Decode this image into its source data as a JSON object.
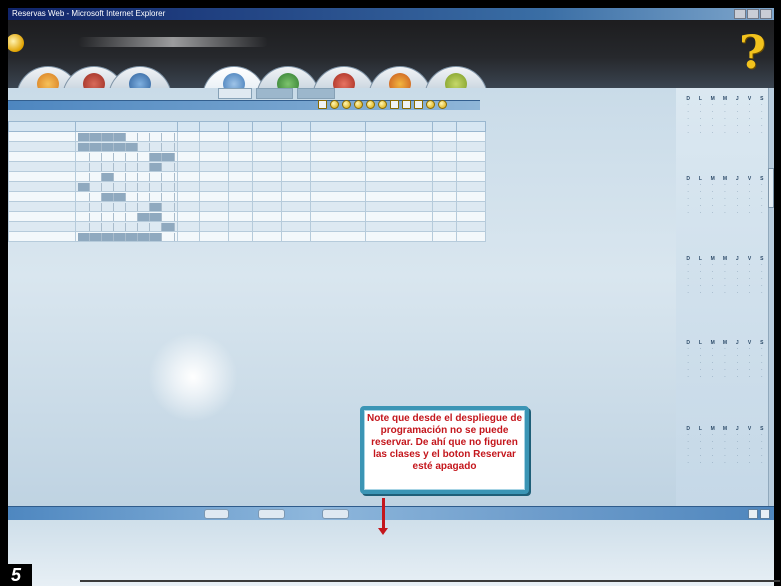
{
  "window": {
    "title": "Reservas Web - Microsoft Internet Explorer"
  },
  "header": {
    "help_glyph": "?"
  },
  "tabs": [
    {
      "name": "tab-1",
      "color": "#e08a2e"
    },
    {
      "name": "tab-2",
      "color": "#b33a2a"
    },
    {
      "name": "tab-3",
      "color": "#2d6db1"
    },
    {
      "name": "tab-4",
      "color": "#3a8f3a"
    },
    {
      "name": "tab-5",
      "color": "#c0392b"
    },
    {
      "name": "tab-6",
      "color": "#d8a21a"
    },
    {
      "name": "tab-7",
      "color": "#6a9a2a"
    }
  ],
  "callout": {
    "text": "Note que desde el despliegue de programación no se puede reservar. De ahí que no figuren las clases y el boton Reservar esté apagado",
    "text_color": "#c4161c",
    "border_color": "#3b95b5"
  },
  "figure": {
    "number": "5"
  },
  "calendar": {
    "weekdays": [
      "D",
      "L",
      "M",
      "M",
      "J",
      "V",
      "S"
    ]
  }
}
